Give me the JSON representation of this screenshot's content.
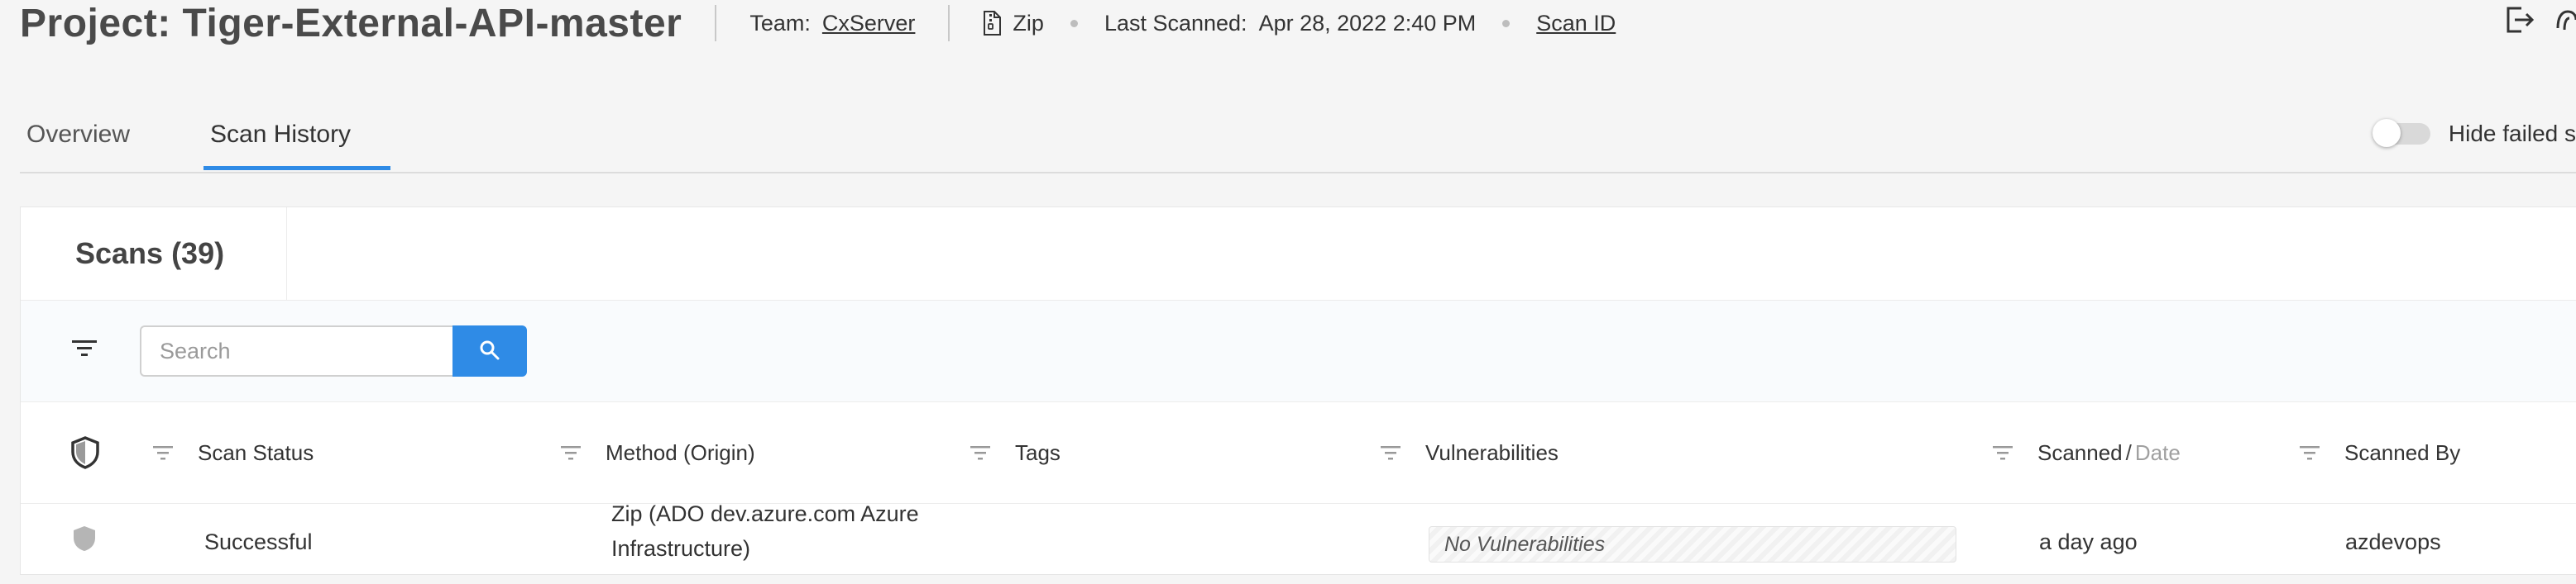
{
  "header": {
    "project_title": "Project: Tiger-External-API-master",
    "team_label": "Team:",
    "team_value": "CxServer",
    "source_type": "Zip",
    "last_scanned_label": "Last Scanned:",
    "last_scanned_value": "Apr 28, 2022 2:40 PM",
    "scan_id_link": "Scan ID",
    "icons": [
      "zip-file-icon",
      "export-icon",
      "fingerprint-icon"
    ]
  },
  "tabs": [
    {
      "label": "Overview",
      "active": false
    },
    {
      "label": "Scan History",
      "active": true
    }
  ],
  "hide_failed": {
    "label": "Hide failed s",
    "enabled": false
  },
  "scans": {
    "title": "Scans (39)",
    "search_placeholder": "Search",
    "search_value": ""
  },
  "columns": {
    "scan_status": "Scan Status",
    "method": "Method (Origin)",
    "tags": "Tags",
    "vulnerabilities": "Vulnerabilities",
    "scanned": "Scanned",
    "date": "Date",
    "scanned_by": "Scanned By"
  },
  "rows": [
    {
      "status": "Successful",
      "method_line1": "Zip (ADO dev.azure.com Azure",
      "method_line2": "Infrastructure)",
      "tags": "",
      "vulnerabilities": "No Vulnerabilities",
      "scanned": "a day ago",
      "scanned_by": "azdevops"
    }
  ],
  "colors": {
    "accent": "#2f8be6",
    "background": "#f5f5f5",
    "card": "#ffffff"
  }
}
